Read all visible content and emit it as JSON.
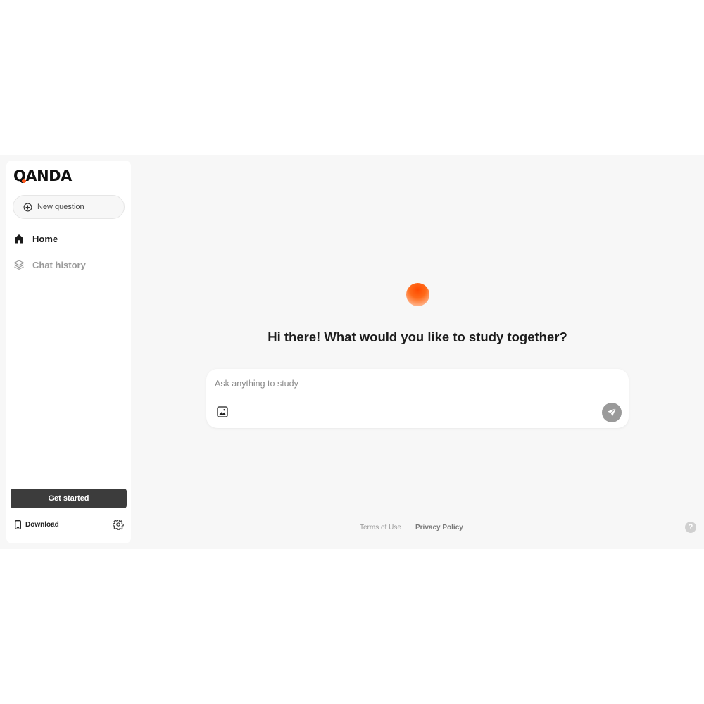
{
  "brand": {
    "logo_text_q": "Q",
    "logo_text_rest": "ANDA",
    "accent_color": "#ff5a1f"
  },
  "sidebar": {
    "new_question_label": "New question",
    "items": [
      {
        "label": "Home",
        "icon": "home-icon",
        "active": true
      },
      {
        "label": "Chat history",
        "icon": "layers-icon",
        "active": false
      }
    ],
    "get_started_label": "Get started",
    "download_label": "Download",
    "download_icon": "phone-icon",
    "settings_icon": "gear-icon"
  },
  "main": {
    "headline": "Hi there! What would you like to study together?",
    "input_placeholder": "Ask anything to study",
    "image_icon": "image-icon",
    "send_icon": "send-icon"
  },
  "footer": {
    "terms_label": "Terms of Use",
    "privacy_label": "Privacy Policy",
    "help_label": "?"
  }
}
